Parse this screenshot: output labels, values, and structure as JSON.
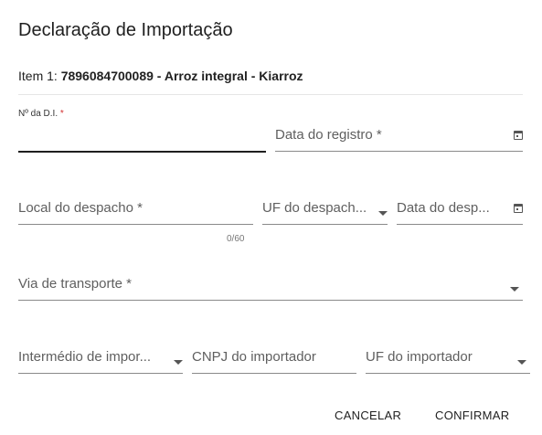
{
  "dialog": {
    "title": "Declaração de Importação",
    "item_prefix": "Item 1: ",
    "item_value": "7896084700089 - Arroz integral - Kiarroz"
  },
  "fields": {
    "num_di": {
      "label": "Nº da D.I.",
      "required_mark": "*",
      "value": ""
    },
    "data_registro": {
      "label": "Data do registro *"
    },
    "local_despacho": {
      "label": "Local do despacho *",
      "counter": "0/60"
    },
    "uf_despacho": {
      "label": "UF do despach..."
    },
    "data_despacho": {
      "label": "Data do desp..."
    },
    "via_transporte": {
      "label": "Via de transporte *"
    },
    "intermedio_importacao": {
      "label": "Intermédio de impor..."
    },
    "cnpj_importador": {
      "label": "CNPJ do importador"
    },
    "uf_importador": {
      "label": "UF do importador"
    }
  },
  "actions": {
    "cancel_label": "CANCELAR",
    "confirm_label": "CONFIRMAR"
  },
  "icons": {
    "calendar": "calendar-icon",
    "dropdown": "chevron-down-icon"
  }
}
